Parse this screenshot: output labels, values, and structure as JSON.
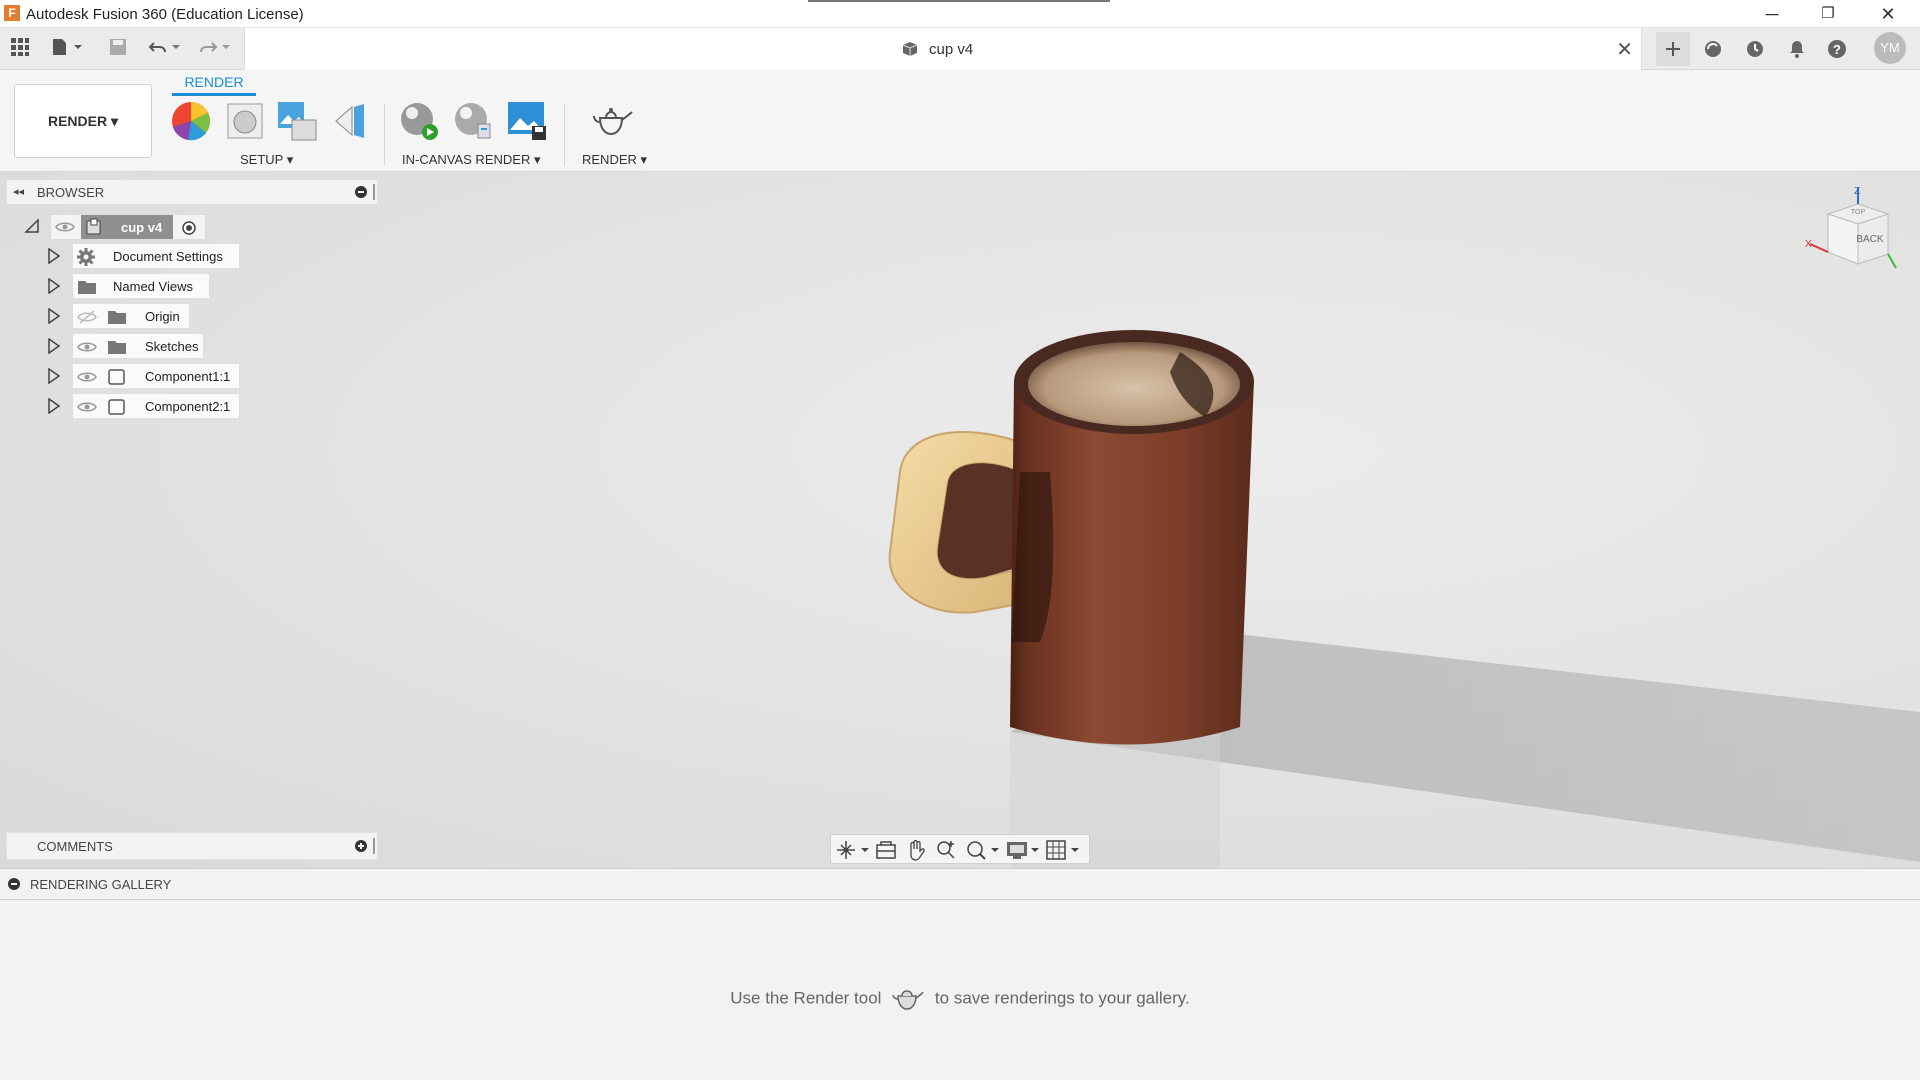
{
  "window": {
    "title": "Autodesk Fusion 360 (Education License)",
    "minimize": "─",
    "restore": "❐",
    "close": "✕"
  },
  "document": {
    "name": "cup v4",
    "close": "✕"
  },
  "user": {
    "initials": "YM"
  },
  "ribbon": {
    "workspace_label": "RENDER",
    "workspace_caret": "▾",
    "active_tab": "RENDER",
    "groups": {
      "setup": "SETUP",
      "in_canvas": "IN-CANVAS RENDER",
      "render": "RENDER"
    },
    "caret": "▾"
  },
  "browser": {
    "title": "BROWSER",
    "root": "cup v4",
    "items": [
      {
        "label": "Document Settings",
        "icon": "gear-icon"
      },
      {
        "label": "Named Views",
        "icon": "folder-icon"
      },
      {
        "label": "Origin",
        "icon": "folder-icon",
        "hidden": true
      },
      {
        "label": "Sketches",
        "icon": "folder-icon"
      },
      {
        "label": "Component1:1",
        "icon": "component-icon"
      },
      {
        "label": "Component2:1",
        "icon": "component-icon"
      }
    ]
  },
  "viewcube": {
    "face": "BACK",
    "top": "TOP",
    "axis_x": "X",
    "axis_z": "Z"
  },
  "comments": {
    "title": "COMMENTS"
  },
  "gallery": {
    "title": "RENDERING GALLERY",
    "message_before": "Use the Render tool",
    "message_after": "to save renderings to your gallery."
  },
  "colors": {
    "accent": "#1c8fd6",
    "cup_body": "#7a3e2c",
    "handle": "#e9c98c"
  }
}
